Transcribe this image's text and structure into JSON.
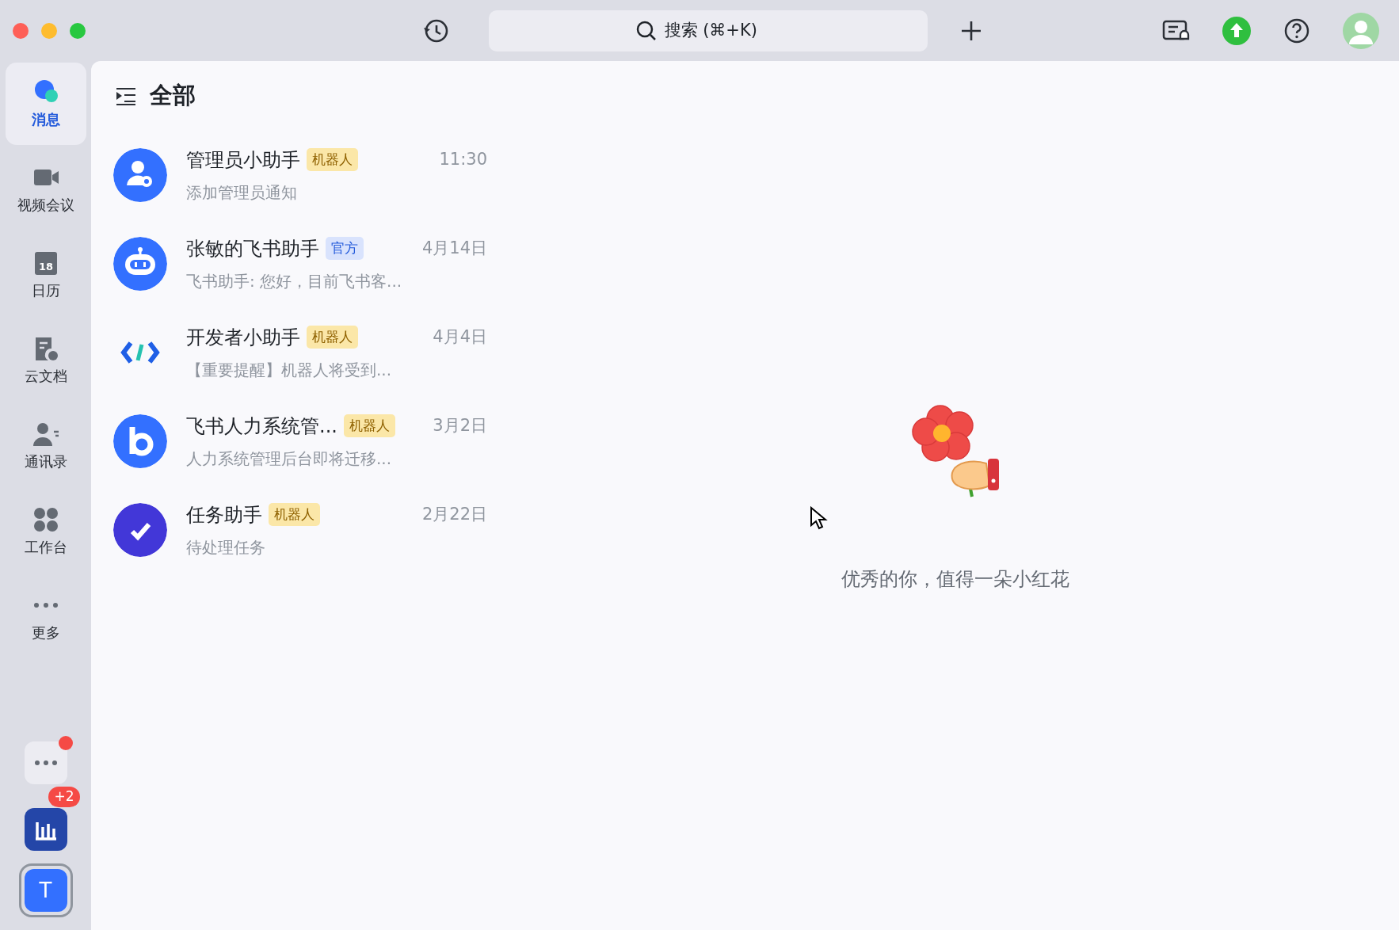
{
  "toolbar": {
    "search": {
      "placeholder": "搜索 (⌘+K)"
    }
  },
  "sidebar": {
    "items": [
      {
        "label": "消息",
        "kind": "chat",
        "selected": true
      },
      {
        "label": "视频会议",
        "kind": "video",
        "selected": false
      },
      {
        "label": "日历",
        "kind": "calendar",
        "selected": false,
        "icon_text": "18"
      },
      {
        "label": "云文档",
        "kind": "doc",
        "selected": false
      },
      {
        "label": "通讯录",
        "kind": "contacts",
        "selected": false
      },
      {
        "label": "工作台",
        "kind": "apps",
        "selected": false
      },
      {
        "label": "更多",
        "kind": "more",
        "selected": false
      }
    ],
    "bottom_apps": [
      {
        "kind": "more-apps",
        "dot": true
      },
      {
        "kind": "chart-app",
        "badge": "+2"
      },
      {
        "kind": "avatar",
        "letter": "T"
      }
    ]
  },
  "list": {
    "title": "全部",
    "chats": [
      {
        "kind": "admin",
        "name": "管理员小助手",
        "tag": {
          "label": "机器人",
          "kind": "bot"
        },
        "time": "11:30",
        "preview": "添加管理员通知"
      },
      {
        "kind": "robot",
        "name": "张敏的飞书助手",
        "tag": {
          "label": "官方",
          "kind": "official"
        },
        "time": "4月14日",
        "preview": "飞书助手: 您好，目前飞书客..."
      },
      {
        "kind": "code",
        "name": "开发者小助手",
        "tag": {
          "label": "机器人",
          "kind": "bot"
        },
        "time": "4月4日",
        "preview": "【重要提醒】机器人将受到..."
      },
      {
        "kind": "letter-b",
        "name": "飞书人力系统管...",
        "tag": {
          "label": "机器人",
          "kind": "bot"
        },
        "time": "3月2日",
        "preview": "人力系统管理后台即将迁移..."
      },
      {
        "kind": "task",
        "name": "任务助手",
        "tag": {
          "label": "机器人",
          "kind": "bot"
        },
        "time": "2月22日",
        "preview": "待处理任务"
      }
    ]
  },
  "empty_state": {
    "message": "优秀的你，值得一朵小红花"
  }
}
